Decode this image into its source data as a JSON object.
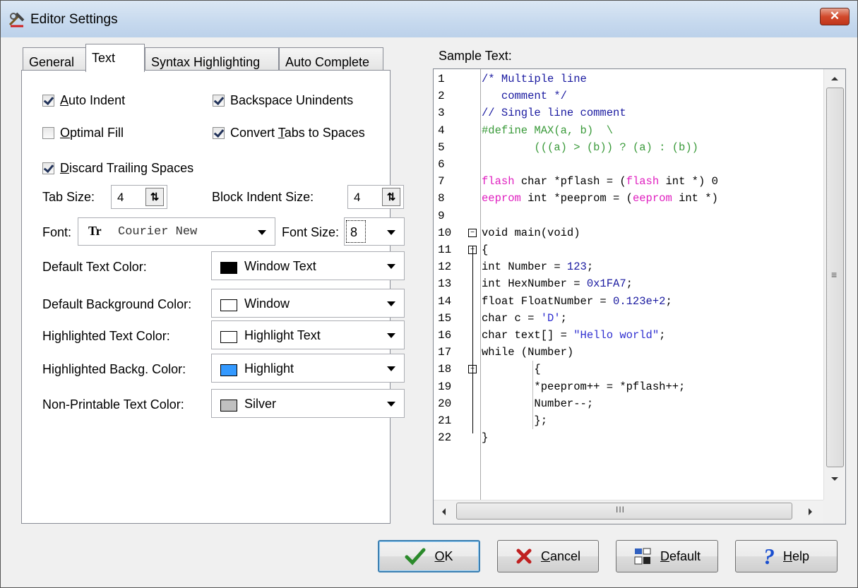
{
  "window": {
    "title": "Editor Settings",
    "close_label": "✕"
  },
  "tabs": [
    {
      "label": "General",
      "active": false
    },
    {
      "label": "Text",
      "active": true
    },
    {
      "label": "Syntax Highlighting",
      "active": false
    },
    {
      "label": "Auto Complete",
      "active": false
    }
  ],
  "options": {
    "auto_indent": {
      "label_u": "A",
      "label_rest": "uto Indent",
      "checked": true
    },
    "backspace_unindents": {
      "label": "Backspace Unindents",
      "checked": true
    },
    "optimal_fill": {
      "label_u": "O",
      "label_rest": "ptimal Fill",
      "checked": false
    },
    "convert_tabs": {
      "label_pre": "Convert ",
      "label_u": "T",
      "label_rest": "abs to Spaces",
      "checked": true
    },
    "discard_trailing": {
      "label_u": "D",
      "label_rest": "iscard Trailing Spaces",
      "checked": true
    }
  },
  "tab_size": {
    "label": "Tab Size:",
    "value": "4"
  },
  "block_indent": {
    "label": "Block Indent Size:",
    "value": "4"
  },
  "font": {
    "label": "Font:",
    "value": "Courier New",
    "icon": "truetype-font-icon"
  },
  "font_size": {
    "label": "Font Size:",
    "value": "8"
  },
  "colors": [
    {
      "label": "Default Text Color:",
      "value": "Window Text",
      "swatch": "#000000"
    },
    {
      "label": "Default Background Color:",
      "value": "Window",
      "swatch": "#ffffff"
    },
    {
      "label": "Highlighted Text Color:",
      "value": "Highlight Text",
      "swatch": "#ffffff"
    },
    {
      "label": "Highlighted Backg. Color:",
      "value": "Highlight",
      "swatch": "#3399ff"
    },
    {
      "label": "Non-Printable Text Color:",
      "value": "Silver",
      "swatch": "#c0c0c0"
    }
  ],
  "sample": {
    "label": "Sample Text:",
    "line_numbers": [
      "1",
      "2",
      "3",
      "4",
      "5",
      "6",
      "7",
      "8",
      "9",
      "10",
      "11",
      "12",
      "13",
      "14",
      "15",
      "16",
      "17",
      "18",
      "19",
      "20",
      "21",
      "22"
    ],
    "lines": [
      [
        {
          "t": "/* Multiple line",
          "c": "#1a1aa0"
        }
      ],
      [
        {
          "t": "   comment */",
          "c": "#1a1aa0"
        }
      ],
      [
        {
          "t": "// Single line comment",
          "c": "#1a1aa0"
        }
      ],
      [
        {
          "t": "#define MAX(a, b)  \\",
          "c": "#3a9a3a"
        }
      ],
      [
        {
          "t": "        (((a) > (b)) ? (a) : (b))",
          "c": "#3a9a3a"
        }
      ],
      [
        {
          "t": "",
          "c": "#000"
        }
      ],
      [
        {
          "t": "flash",
          "c": "#e020c0"
        },
        {
          "t": " char *pflash = (",
          "c": "#000"
        },
        {
          "t": "flash",
          "c": "#e020c0"
        },
        {
          "t": " int *) 0",
          "c": "#000"
        }
      ],
      [
        {
          "t": "eeprom",
          "c": "#e020c0"
        },
        {
          "t": " int *peeprom = (",
          "c": "#000"
        },
        {
          "t": "eeprom",
          "c": "#e020c0"
        },
        {
          "t": " int *)",
          "c": "#000"
        }
      ],
      [
        {
          "t": "",
          "c": "#000"
        }
      ],
      [
        {
          "t": "void main(void)",
          "c": "#000"
        }
      ],
      [
        {
          "t": "{",
          "c": "#000"
        }
      ],
      [
        {
          "t": "int Number = ",
          "c": "#000"
        },
        {
          "t": "123",
          "c": "#1a1aa0"
        },
        {
          "t": ";",
          "c": "#000"
        }
      ],
      [
        {
          "t": "int HexNumber = ",
          "c": "#000"
        },
        {
          "t": "0x1FA7",
          "c": "#1a1aa0"
        },
        {
          "t": ";",
          "c": "#000"
        }
      ],
      [
        {
          "t": "float FloatNumber = ",
          "c": "#000"
        },
        {
          "t": "0.123e+2",
          "c": "#1a1aa0"
        },
        {
          "t": ";",
          "c": "#000"
        }
      ],
      [
        {
          "t": "char c = ",
          "c": "#000"
        },
        {
          "t": "'D'",
          "c": "#3030d0"
        },
        {
          "t": ";",
          "c": "#000"
        }
      ],
      [
        {
          "t": "char text[] = ",
          "c": "#000"
        },
        {
          "t": "\"Hello world\"",
          "c": "#3030d0"
        },
        {
          "t": ";",
          "c": "#000"
        }
      ],
      [
        {
          "t": "while (Number)",
          "c": "#000"
        }
      ],
      [
        {
          "t": "        {",
          "c": "#000"
        }
      ],
      [
        {
          "t": "        *peeprom++ = *pflash++;",
          "c": "#000"
        }
      ],
      [
        {
          "t": "        Number--;",
          "c": "#000"
        }
      ],
      [
        {
          "t": "        };",
          "c": "#000"
        }
      ],
      [
        {
          "t": "}",
          "c": "#000"
        }
      ]
    ],
    "fold_markers": [
      10,
      11,
      18
    ],
    "scroll_grip": "≡",
    "hscroll_grip": "III"
  },
  "buttons": {
    "ok": {
      "label_u": "O",
      "label_rest": "K",
      "icon": "checkmark-icon"
    },
    "cancel": {
      "label_u": "C",
      "label_rest": "ancel",
      "icon": "x-icon"
    },
    "default": {
      "label_u": "D",
      "label_rest": "efault",
      "icon": "default-icon"
    },
    "help": {
      "label_u": "H",
      "label_rest": "elp",
      "icon": "question-icon"
    }
  }
}
